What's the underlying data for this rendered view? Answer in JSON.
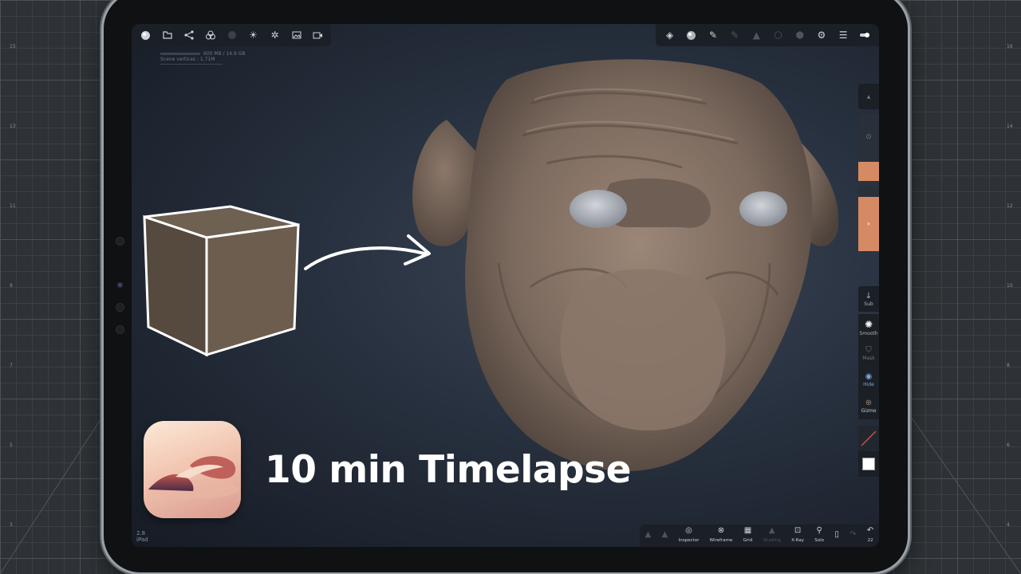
{
  "overlay": {
    "title": "10 min Timelapse",
    "app_icon": "nomad-sculpt-logo"
  },
  "app": {
    "stats": {
      "memory": "600 MB / 14.9 GB",
      "vertices": "Scene vertices : 1.71M"
    },
    "version": {
      "number": "2.8",
      "device": "iPad"
    },
    "toolbar_left": [
      {
        "icon": "sphere-icon"
      },
      {
        "icon": "folder-icon"
      },
      {
        "icon": "share-nodes-icon"
      },
      {
        "icon": "layers-icon"
      },
      {
        "icon": "circle-icon"
      },
      {
        "icon": "sun-icon"
      },
      {
        "icon": "gear-wheel-icon"
      },
      {
        "icon": "image-icon"
      },
      {
        "icon": "video-icon"
      }
    ],
    "toolbar_right": [
      {
        "icon": "material-icon"
      },
      {
        "icon": "matcap-icon"
      },
      {
        "icon": "brush-icon"
      },
      {
        "icon": "pen-icon"
      },
      {
        "icon": "triangle-icon"
      },
      {
        "icon": "lock-icon"
      },
      {
        "icon": "settings-icon"
      },
      {
        "icon": "sliders-icon"
      },
      {
        "icon": "toggle-icon"
      }
    ],
    "right_tools": {
      "sub_label": "Sub",
      "smooth_label": "Smooth",
      "mask_label": "Mask",
      "hide_label": "Hide",
      "gizmo_label": "Gizmo"
    },
    "bottom_toolbar": [
      {
        "label": "",
        "icon": "triangle-icon"
      },
      {
        "label": "",
        "icon": "triangle-icon"
      },
      {
        "label": "Inspector",
        "icon": "inspector-icon"
      },
      {
        "label": "Wireframe",
        "icon": "wireframe-icon"
      },
      {
        "label": "Grid",
        "icon": "grid-icon"
      },
      {
        "label": "Shading",
        "icon": "triangle-icon"
      },
      {
        "label": "X-Ray",
        "icon": "xray-icon"
      },
      {
        "label": "Solo",
        "icon": "search-icon"
      },
      {
        "label": "",
        "icon": "phone-icon"
      },
      {
        "label": "",
        "icon": "redo-icon"
      },
      {
        "label": "22",
        "icon": "undo-icon"
      }
    ],
    "accent_color": "#d68a63"
  }
}
